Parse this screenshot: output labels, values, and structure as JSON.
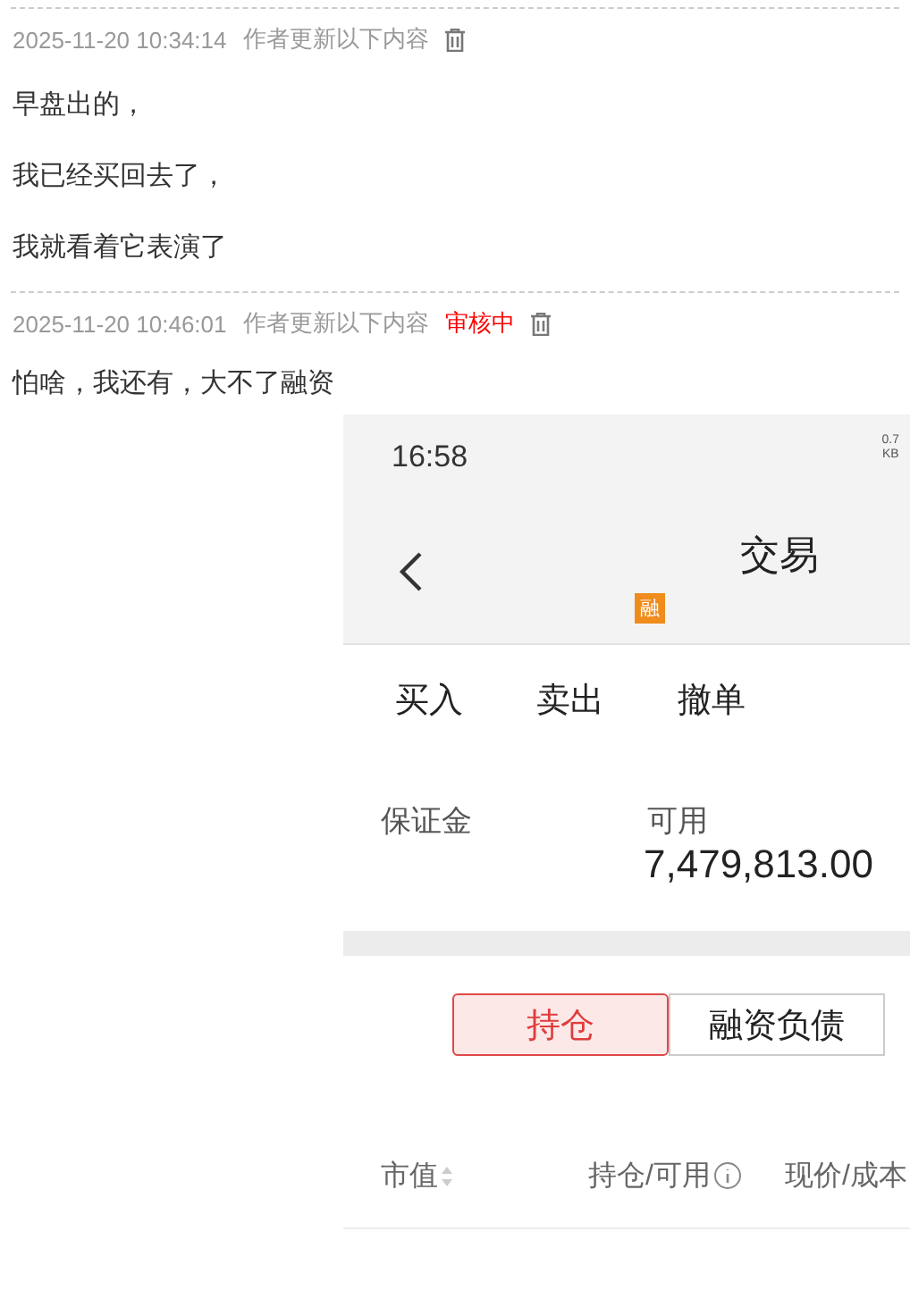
{
  "posts": [
    {
      "time": "2025-11-20 10:34:14",
      "note": "作者更新以下内容",
      "paragraphs": [
        "早盘出的，",
        "我已经买回去了，",
        "我就看着它表演了"
      ]
    },
    {
      "time": "2025-11-20 10:46:01",
      "note": "作者更新以下内容",
      "status": "审核中",
      "paragraphs": [
        "怕啥，我还有，大不了融资"
      ]
    }
  ],
  "phone": {
    "status_bar": {
      "time": "16:58",
      "net_speed": "0.7",
      "net_unit": "KB"
    },
    "header": {
      "title": "交易",
      "badge": "融"
    },
    "actions": [
      "买入",
      "卖出",
      "撤单"
    ],
    "account": {
      "labels": [
        "保证金",
        "可用"
      ],
      "available": "7,479,813.00"
    },
    "tabs": [
      {
        "label": "持仓",
        "selected": true
      },
      {
        "label": "融资负债",
        "selected": false
      }
    ],
    "columns": [
      {
        "label": "市值",
        "kind": "sort"
      },
      {
        "label": "持仓/可用",
        "kind": "info"
      },
      {
        "label": "现价/成本"
      }
    ]
  }
}
